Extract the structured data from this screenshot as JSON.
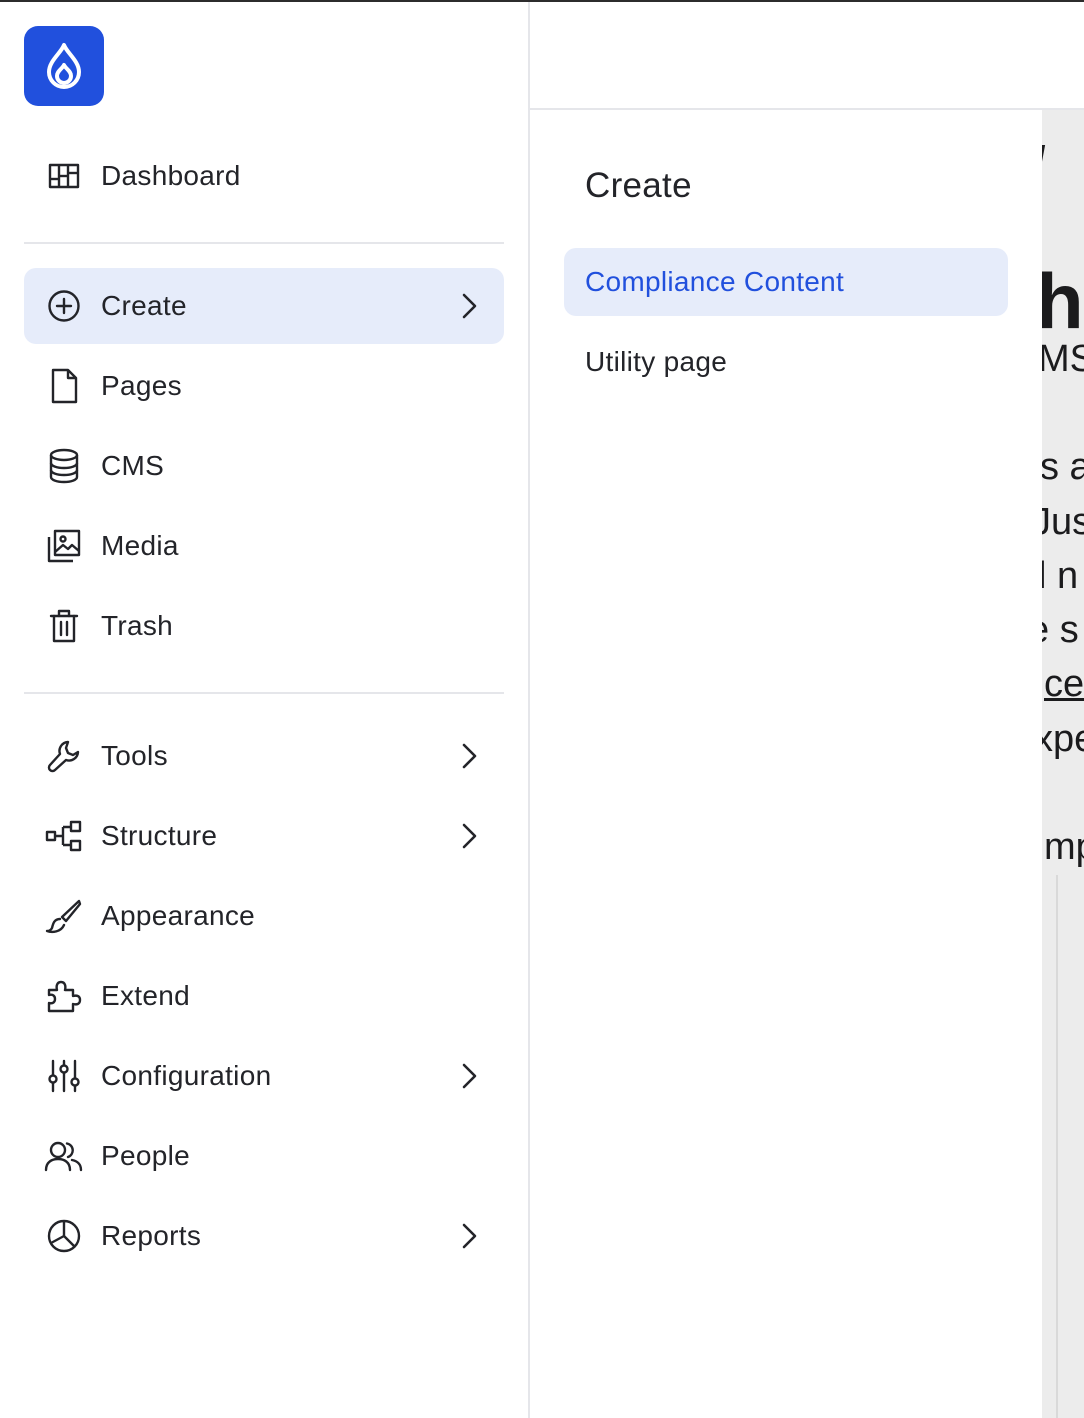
{
  "app": {
    "logo": "drupal-drop-logo",
    "accent": "#2150dd",
    "active_bg": "#e6ecfa"
  },
  "sidebar": {
    "items": [
      {
        "label": "Dashboard",
        "icon": "dashboard-icon"
      },
      {
        "label": "Create",
        "icon": "plus-circle-icon",
        "active": true,
        "has_submenu": true
      },
      {
        "label": "Pages",
        "icon": "file-icon"
      },
      {
        "label": "CMS",
        "icon": "database-icon"
      },
      {
        "label": "Media",
        "icon": "media-icon"
      },
      {
        "label": "Trash",
        "icon": "trash-icon"
      },
      {
        "label": "Tools",
        "icon": "wrench-icon",
        "has_submenu": true
      },
      {
        "label": "Structure",
        "icon": "structure-icon",
        "has_submenu": true
      },
      {
        "label": "Appearance",
        "icon": "brush-icon"
      },
      {
        "label": "Extend",
        "icon": "puzzle-icon"
      },
      {
        "label": "Configuration",
        "icon": "sliders-icon",
        "has_submenu": true
      },
      {
        "label": "People",
        "icon": "people-icon"
      },
      {
        "label": "Reports",
        "icon": "pie-chart-icon",
        "has_submenu": true
      }
    ]
  },
  "flyout": {
    "title": "Create",
    "items": [
      {
        "label": "Compliance Content",
        "active": true
      },
      {
        "label": "Utility page"
      }
    ]
  },
  "background_page": {
    "fragments": [
      "/",
      "he",
      "MS",
      "s a",
      "Jus",
      "l n",
      "e s",
      "ce",
      "xpe",
      "mp"
    ]
  }
}
